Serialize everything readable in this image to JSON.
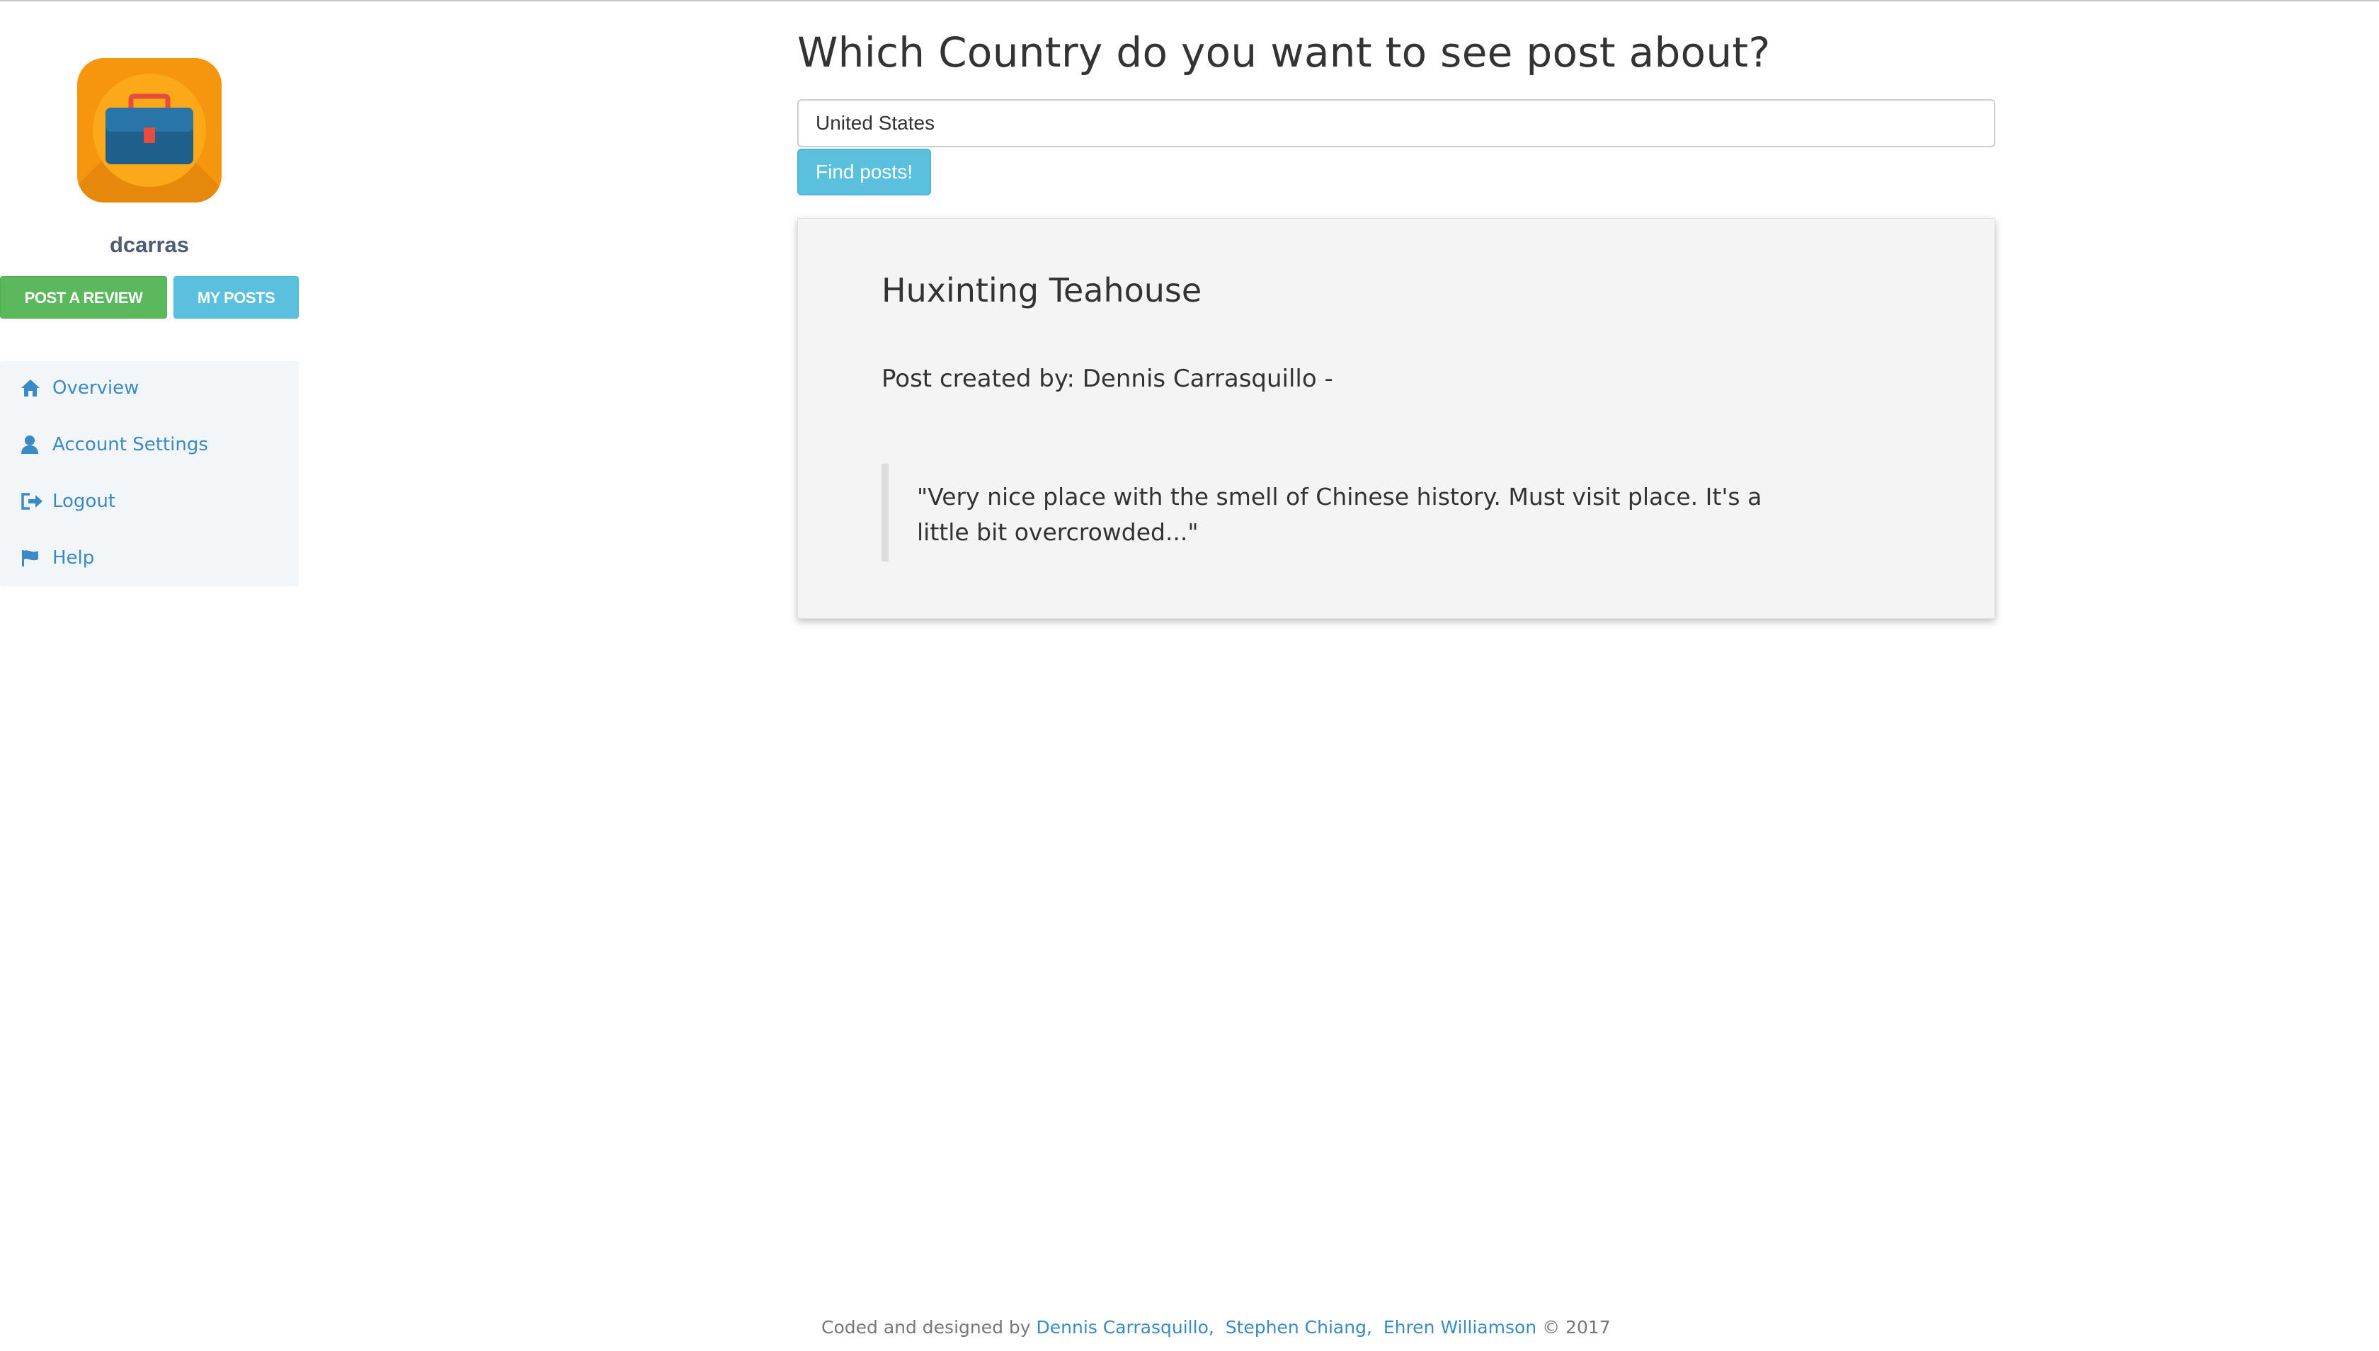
{
  "sidebar": {
    "username": "dcarras",
    "buttons": {
      "post_review": "POST A REVIEW",
      "my_posts": "MY POSTS"
    },
    "nav": [
      {
        "label": "Overview",
        "icon": "home-icon"
      },
      {
        "label": "Account Settings",
        "icon": "user-icon"
      },
      {
        "label": "Logout",
        "icon": "logout-icon"
      },
      {
        "label": "Help",
        "icon": "flag-icon"
      }
    ]
  },
  "main": {
    "question": "Which Country do you want to see post about?",
    "country_input_value": "United States",
    "find_button": "Find posts!",
    "post": {
      "title": "Huxinting Teahouse",
      "author_line": "Post created by: Dennis Carrasquillo -",
      "quote": "\"Very nice place with the smell of Chinese history. Must visit place. It's a little bit overcrowded...\""
    }
  },
  "footer": {
    "prefix": "Coded and designed by",
    "authors": [
      "Dennis Carrasquillo,",
      "Stephen Chiang,",
      "Ehren Williamson"
    ],
    "suffix": "© 2017"
  },
  "colors": {
    "success": "#5cb85c",
    "info": "#5bc0de",
    "link": "#3a8ac5",
    "logo_orange": "#f6960f"
  }
}
